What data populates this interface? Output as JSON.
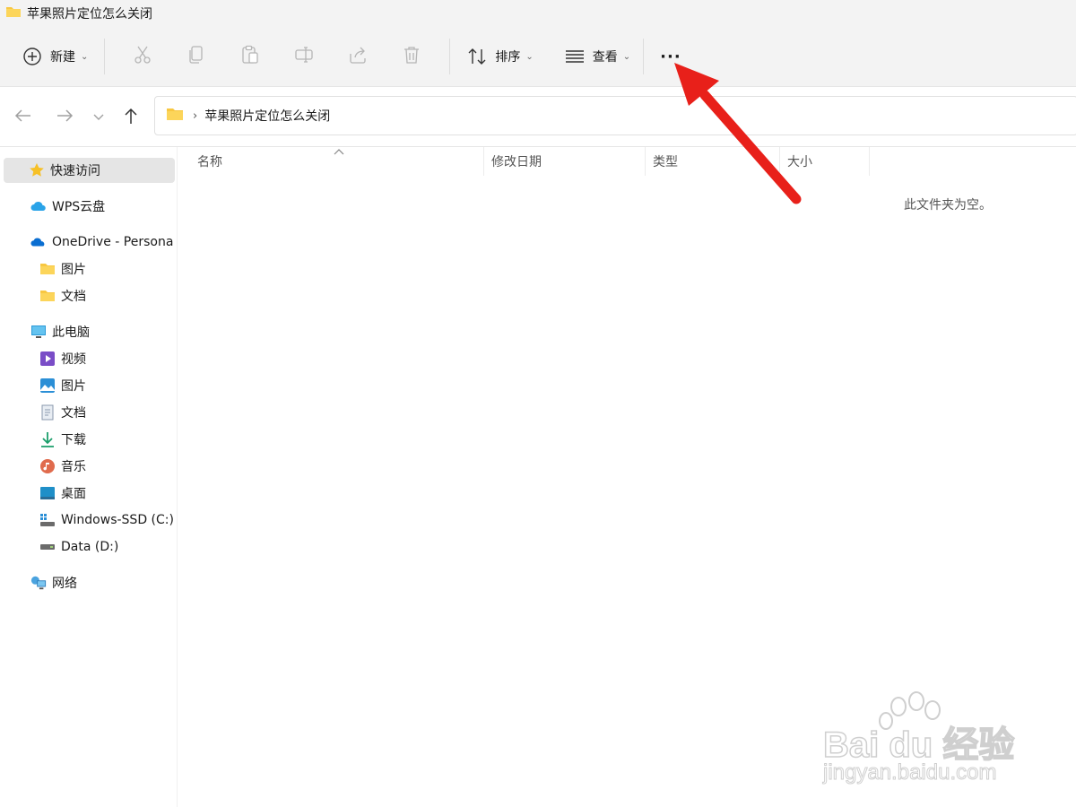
{
  "window": {
    "title": "苹果照片定位怎么关闭"
  },
  "toolbar": {
    "new_label": "新建",
    "sort_label": "排序",
    "view_label": "查看",
    "more_label": "···"
  },
  "address": {
    "crumb": "苹果照片定位怎么关闭"
  },
  "sidebar": {
    "items": [
      {
        "label": "快速访问",
        "icon": "star-icon"
      },
      {
        "label": "WPS云盘",
        "icon": "cloud-icon"
      },
      {
        "label": "OneDrive - Persona",
        "icon": "onedrive-icon"
      },
      {
        "label": "图片",
        "icon": "folder-icon"
      },
      {
        "label": "文档",
        "icon": "folder-icon"
      },
      {
        "label": "此电脑",
        "icon": "monitor-icon"
      },
      {
        "label": "视频",
        "icon": "video-icon"
      },
      {
        "label": "图片",
        "icon": "pictures-icon"
      },
      {
        "label": "文档",
        "icon": "document-icon"
      },
      {
        "label": "下载",
        "icon": "download-icon"
      },
      {
        "label": "音乐",
        "icon": "music-icon"
      },
      {
        "label": "桌面",
        "icon": "desktop-icon"
      },
      {
        "label": "Windows-SSD (C:)",
        "icon": "drive-c-icon"
      },
      {
        "label": "Data (D:)",
        "icon": "drive-d-icon"
      },
      {
        "label": "网络",
        "icon": "network-icon"
      }
    ]
  },
  "columns": [
    "名称",
    "修改日期",
    "类型",
    "大小"
  ],
  "content": {
    "empty_message": "此文件夹为空。"
  },
  "watermark": {
    "brand": "Bai du 经验",
    "url": "jingyan.baidu.com"
  },
  "colors": {
    "arrow": "#e8201a",
    "folder": "#f8c741",
    "onedrive": "#0a6ed1"
  }
}
